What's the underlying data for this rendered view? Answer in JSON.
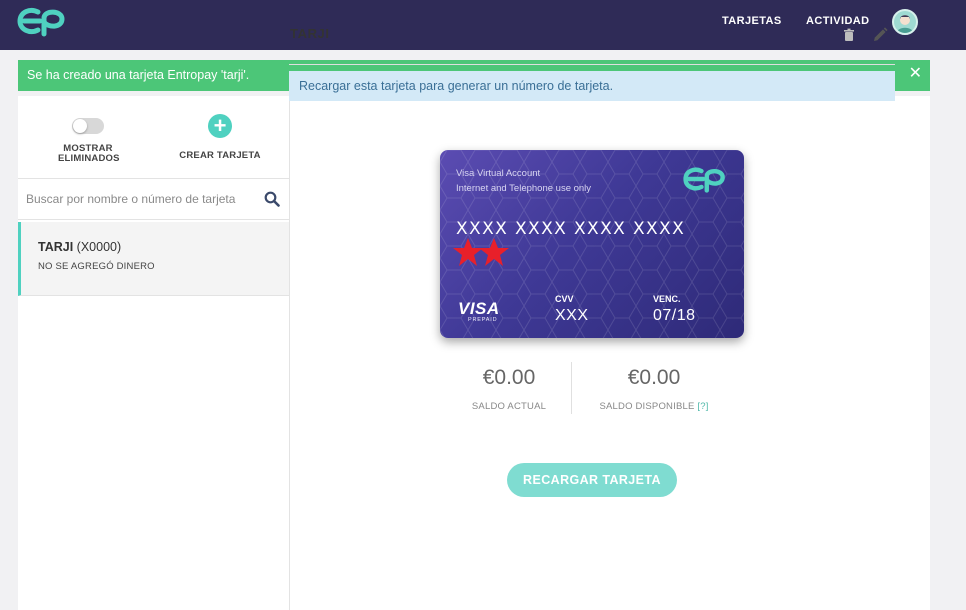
{
  "brand": {
    "logo_icon": "entropay-logo-icon",
    "accent": "#4fd1c0",
    "nav_bg": "#2f2b57"
  },
  "nav": {
    "cards": "TARJETAS",
    "activity": "ACTIVIDAD",
    "avatar_icon": "user-avatar-icon"
  },
  "alert": {
    "message": "Se ha creado una tarjeta Entropay 'tarji'.",
    "close_icon": "close-icon",
    "color": "#4cc678"
  },
  "sidebar": {
    "toggle_label_line1": "MOSTRAR",
    "toggle_label_line2": "ELIMINADOS",
    "create_label": "CREAR TARJETA",
    "create_icon": "plus-circle-icon",
    "search": {
      "placeholder": "Buscar por nombre o número de tarjeta",
      "value": "",
      "icon": "search-icon"
    },
    "cards": [
      {
        "name": "TARJI",
        "suffix": "(X0000)",
        "status": "NO SE AGREGÓ DINERO"
      }
    ]
  },
  "detail": {
    "title": "TARJI",
    "trash_icon": "trash-icon",
    "edit_icon": "pencil-icon",
    "info": "Recargar esta tarjeta para generar un número de tarjeta.",
    "card": {
      "line1": "Visa Virtual Account",
      "line2": "Internet and Telephone use only",
      "number": "XXXX XXXX XXXX XXXX",
      "redaction_icon": "red-stars-redaction-icon",
      "brand": "VISA",
      "brand_sub": "PREPAID",
      "cvv_label": "CVV",
      "cvv": "XXX",
      "exp_label": "VENC.",
      "exp": "07/18"
    },
    "balance_current": {
      "amount": "€0.00",
      "label": "SALDO ACTUAL"
    },
    "balance_available": {
      "amount": "€0.00",
      "label": "SALDO DISPONIBLE",
      "help": "[?]"
    },
    "topup_button": "RECARGAR TARJETA"
  }
}
